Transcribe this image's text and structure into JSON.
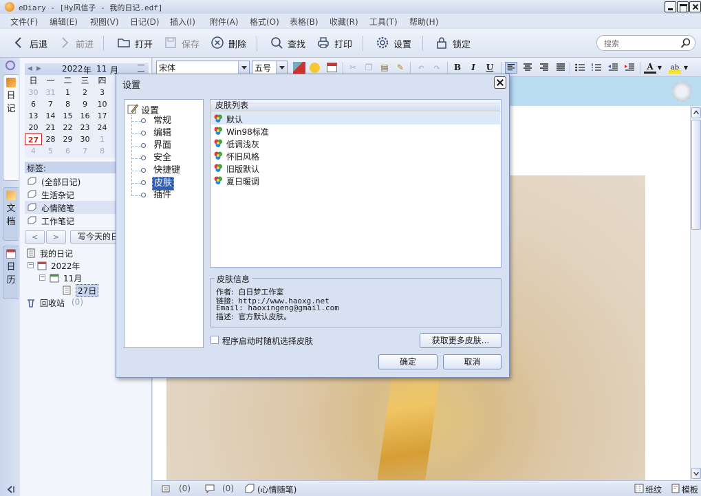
{
  "window": {
    "title": "eDiary - [Hy风信子 - 我的日记.edf]"
  },
  "menu": [
    "文件(F)",
    "编辑(E)",
    "视图(V)",
    "日记(D)",
    "插入(I)",
    "附件(A)",
    "格式(O)",
    "表格(B)",
    "收藏(R)",
    "工具(T)",
    "帮助(H)"
  ],
  "toolbar": {
    "back": "后退",
    "forward": "前进",
    "open": "打开",
    "save": "保存",
    "delete": "删除",
    "find": "查找",
    "print": "打印",
    "settings": "设置",
    "lock": "锁定",
    "search_placeholder": "搜索"
  },
  "left_tabs": {
    "diary": "日记",
    "docs": "文档",
    "calendar": "日历"
  },
  "calendar": {
    "year": "2022",
    "year_unit": "年",
    "month": "11",
    "month_unit": "月",
    "weekdays": [
      "日",
      "一",
      "二",
      "三",
      "四"
    ],
    "weeks": [
      [
        {
          "d": "30",
          "o": true
        },
        {
          "d": "31",
          "o": true
        },
        {
          "d": "1"
        },
        {
          "d": "2"
        },
        {
          "d": "3"
        }
      ],
      [
        {
          "d": "6"
        },
        {
          "d": "7"
        },
        {
          "d": "8"
        },
        {
          "d": "9"
        },
        {
          "d": "10"
        }
      ],
      [
        {
          "d": "13"
        },
        {
          "d": "14"
        },
        {
          "d": "15"
        },
        {
          "d": "16"
        },
        {
          "d": "17"
        }
      ],
      [
        {
          "d": "20"
        },
        {
          "d": "21"
        },
        {
          "d": "22"
        },
        {
          "d": "23"
        },
        {
          "d": "24"
        }
      ],
      [
        {
          "d": "27",
          "today": true
        },
        {
          "d": "28"
        },
        {
          "d": "29"
        },
        {
          "d": "30"
        },
        {
          "d": "1",
          "o": true
        }
      ],
      [
        {
          "d": "4",
          "o": true
        },
        {
          "d": "5",
          "o": true
        },
        {
          "d": "6",
          "o": true
        },
        {
          "d": "7",
          "o": true
        },
        {
          "d": "8",
          "o": true
        }
      ]
    ]
  },
  "tags": {
    "header": "标签:",
    "items": [
      "(全部日记)",
      "生活杂记",
      "心情随笔",
      "工作笔记"
    ]
  },
  "nav": {
    "prev": "<",
    "next": ">",
    "write_today": "写今天的日记"
  },
  "tree": {
    "root": "我的日记",
    "year": "2022年",
    "month": "11月",
    "day": "27日",
    "recycle": "回收站",
    "recycle_count": "(0)"
  },
  "format": {
    "font": "宋体",
    "size": "五号",
    "bold": "B",
    "italic": "I",
    "underline": "U"
  },
  "status": {
    "attachments": "(0)",
    "comments": "(0)",
    "tag": "(心情随笔)",
    "paper": "纸纹",
    "template": "模板"
  },
  "dialog": {
    "title": "设置",
    "tree_root": "设置",
    "tree_items": [
      "常规",
      "编辑",
      "界面",
      "安全",
      "快捷键",
      "皮肤",
      "插件"
    ],
    "skin_list_header": "皮肤列表",
    "skins": [
      "默认",
      "Win98标准",
      "低调浅灰",
      "怀旧风格",
      "旧版默认",
      "夏日暖调"
    ],
    "skin_info_title": "皮肤信息",
    "info": {
      "author_label": "作者:",
      "author": "白日梦工作室",
      "link_label": "链接:",
      "link": "http://www.haoxg.net",
      "email_label": "Email:",
      "email": "haoxingeng@gmail.com",
      "desc_label": "描述:",
      "desc": "官方默认皮肤。"
    },
    "random_skin_label": "程序启动时随机选择皮肤",
    "random_skin_checked": false,
    "get_more": "获取更多皮肤...",
    "ok": "确定",
    "cancel": "取消"
  },
  "colors": {
    "accent": "#2f5fbd",
    "today": "#c62828",
    "chrome": "#d6dff0"
  }
}
